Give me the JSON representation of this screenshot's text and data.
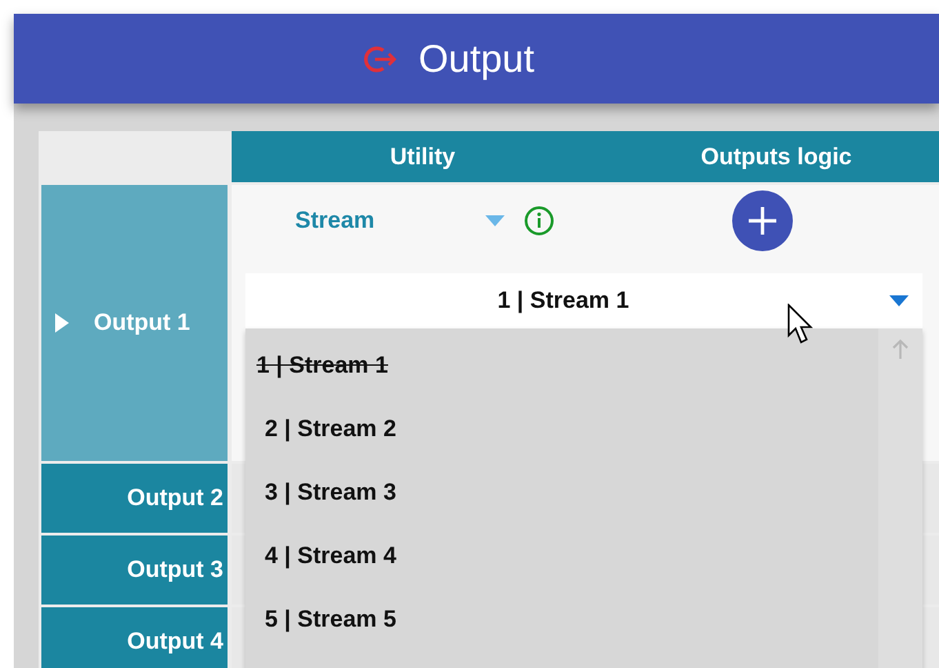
{
  "window": {
    "title": "Output"
  },
  "table": {
    "columns": [
      "Utility",
      "Outputs logic"
    ],
    "rows": [
      {
        "label": "Output 1",
        "selected": true,
        "utility": "Stream",
        "value": "1 | Stream 1"
      },
      {
        "label": "Output 2",
        "selected": false
      },
      {
        "label": "Output 3",
        "selected": false
      },
      {
        "label": "Output 4",
        "selected": false
      }
    ]
  },
  "dropdown": {
    "items": [
      {
        "label": "1 | Stream 1",
        "disabled": true
      },
      {
        "label": "2 | Stream 2",
        "disabled": false
      },
      {
        "label": "3 | Stream 3",
        "disabled": false
      },
      {
        "label": "4 | Stream 4",
        "disabled": false
      },
      {
        "label": "5 | Stream 5",
        "disabled": false
      }
    ]
  }
}
